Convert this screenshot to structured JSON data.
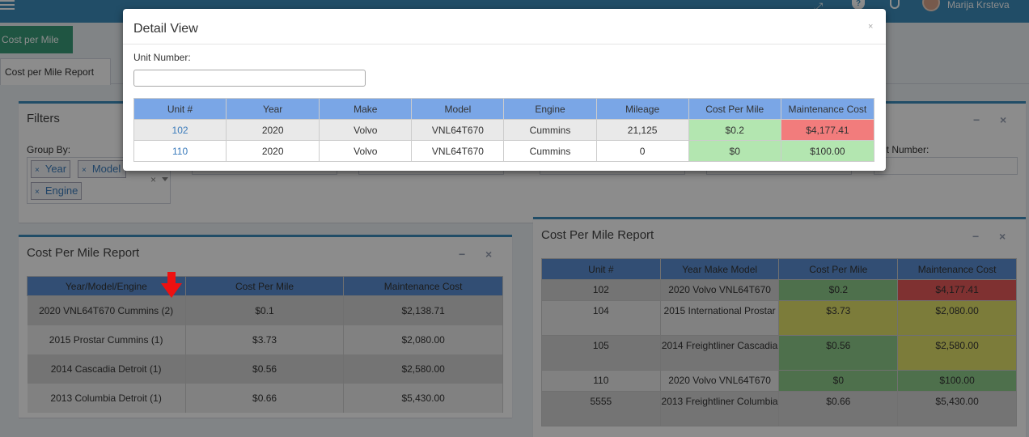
{
  "topbar": {
    "menu_icon": "hamburger-icon",
    "expand_icon": "expand-icon",
    "help_icon": "help-icon",
    "bell_icon": "bell-icon",
    "user_name": "Marija Krsteva"
  },
  "nav": {
    "cost_per_mile_button": "Cost per Mile",
    "tab_label": "Cost per Mile Report"
  },
  "filters": {
    "title": "Filters",
    "group_by_label": "Group By:",
    "tags": [
      "Year",
      "Model",
      "Engine"
    ],
    "unit_number_label": "it Number:"
  },
  "left_report": {
    "title": "Cost Per Mile Report",
    "columns": [
      "Year/Model/Engine",
      "Cost Per Mile",
      "Maintenance Cost"
    ],
    "rows": [
      [
        "2020 VNL64T670 Cummins (2)",
        "$0.1",
        "$2,138.71"
      ],
      [
        "2015 Prostar Cummins (1)",
        "$3.73",
        "$2,080.00"
      ],
      [
        "2014 Cascadia Detroit (1)",
        "$0.56",
        "$2,580.00"
      ],
      [
        "2013 Columbia Detroit (1)",
        "$0.66",
        "$5,430.00"
      ]
    ]
  },
  "right_report": {
    "title": "Cost Per Mile Report",
    "columns": [
      "Unit #",
      "Year Make Model",
      "Cost Per Mile",
      "Maintenance Cost"
    ],
    "rows": [
      [
        "102",
        "2020 Volvo VNL64T670",
        "$0.2",
        "$4,177.41"
      ],
      [
        "104",
        "2015 International Prostar",
        "$3.73",
        "$2,080.00"
      ],
      [
        "105",
        "2014 Freightliner Cascadia",
        "$0.56",
        "$2,580.00"
      ],
      [
        "110",
        "2020 Volvo VNL64T670",
        "$0",
        "$100.00"
      ],
      [
        "5555",
        "2013 Freightliner Columbia",
        "$0.66",
        "$5,430.00"
      ]
    ]
  },
  "modal": {
    "title": "Detail View",
    "close": "×",
    "unit_label": "Unit Number:",
    "unit_value": "",
    "columns": [
      "Unit #",
      "Year",
      "Make",
      "Model",
      "Engine",
      "Mileage",
      "Cost Per Mile",
      "Maintenance Cost"
    ],
    "rows": [
      [
        "102",
        "2020",
        "Volvo",
        "VNL64T670",
        "Cummins",
        "21,125",
        "$0.2",
        "$4,177.41"
      ],
      [
        "110",
        "2020",
        "Volvo",
        "VNL64T670",
        "Cummins",
        "0",
        "$0",
        "$100.00"
      ]
    ]
  },
  "colors": {
    "header_blue": "#3c8dbc",
    "table_header": "#7aa6e6",
    "good": "#b3e6b0",
    "bad": "#f27c7c",
    "warn": "#e2e26a"
  }
}
